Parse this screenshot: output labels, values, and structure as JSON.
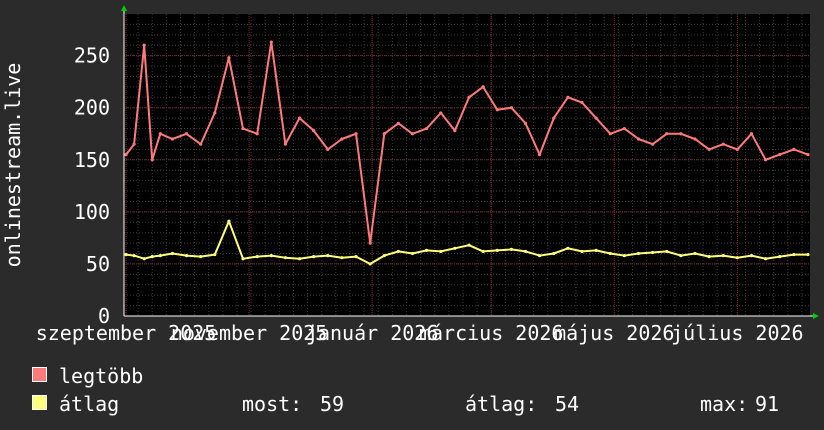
{
  "chart_data": {
    "type": "line",
    "ylabel": "onlinestream.live",
    "ylim": [
      0,
      290
    ],
    "yticks": [
      0,
      50,
      100,
      150,
      200,
      250
    ],
    "x_tick_labels": [
      "szeptember 2025",
      "november 2025",
      "január 2026",
      "március 2026",
      "május 2026",
      "július 2026"
    ],
    "x_range": [
      "2025-08-31",
      "2026-08-06"
    ],
    "x_tick_dates": [
      "2025-09-01",
      "2025-11-01",
      "2026-01-01",
      "2026-03-01",
      "2026-05-01",
      "2026-07-01"
    ],
    "grid": true,
    "colors": {
      "max": "#ff7b7b",
      "avg": "#ffff7b",
      "background": "#000000",
      "grid_minor": "#3a3a3a",
      "grid_major": "#7a2a2a",
      "axis_arrow": "#00cc00"
    },
    "series": [
      {
        "name": "legtöbb",
        "color": "#ff7b7b",
        "x": [
          "2025-09-01",
          "2025-09-05",
          "2025-09-10",
          "2025-09-14",
          "2025-09-18",
          "2025-09-24",
          "2025-10-01",
          "2025-10-08",
          "2025-10-15",
          "2025-10-22",
          "2025-10-29",
          "2025-11-05",
          "2025-11-12",
          "2025-11-19",
          "2025-11-26",
          "2025-12-03",
          "2025-12-10",
          "2025-12-17",
          "2025-12-24",
          "2025-12-31",
          "2026-01-07",
          "2026-01-14",
          "2026-01-21",
          "2026-01-28",
          "2026-02-04",
          "2026-02-11",
          "2026-02-18",
          "2026-02-25",
          "2026-03-04",
          "2026-03-11",
          "2026-03-18",
          "2026-03-25",
          "2026-04-01",
          "2026-04-08",
          "2026-04-15",
          "2026-04-22",
          "2026-04-29",
          "2026-05-06",
          "2026-05-13",
          "2026-05-20",
          "2026-05-27",
          "2026-06-03",
          "2026-06-10",
          "2026-06-17",
          "2026-06-24",
          "2026-07-01",
          "2026-07-08",
          "2026-07-15",
          "2026-07-22",
          "2026-07-29",
          "2026-08-05"
        ],
        "values": [
          155,
          165,
          260,
          150,
          175,
          170,
          175,
          165,
          195,
          248,
          180,
          175,
          263,
          165,
          190,
          178,
          160,
          170,
          175,
          70,
          175,
          185,
          175,
          180,
          195,
          178,
          210,
          220,
          198,
          200,
          185,
          155,
          190,
          210,
          205,
          190,
          175,
          180,
          170,
          165,
          175,
          175,
          170,
          160,
          165,
          160,
          175,
          150,
          155,
          160,
          155
        ]
      },
      {
        "name": "átlag",
        "color": "#ffff7b",
        "x": [
          "2025-09-01",
          "2025-09-05",
          "2025-09-10",
          "2025-09-14",
          "2025-09-18",
          "2025-09-24",
          "2025-10-01",
          "2025-10-08",
          "2025-10-15",
          "2025-10-22",
          "2025-10-29",
          "2025-11-05",
          "2025-11-12",
          "2025-11-19",
          "2025-11-26",
          "2025-12-03",
          "2025-12-10",
          "2025-12-17",
          "2025-12-24",
          "2025-12-31",
          "2026-01-07",
          "2026-01-14",
          "2026-01-21",
          "2026-01-28",
          "2026-02-04",
          "2026-02-11",
          "2026-02-18",
          "2026-02-25",
          "2026-03-04",
          "2026-03-11",
          "2026-03-18",
          "2026-03-25",
          "2026-04-01",
          "2026-04-08",
          "2026-04-15",
          "2026-04-22",
          "2026-04-29",
          "2026-05-06",
          "2026-05-13",
          "2026-05-20",
          "2026-05-27",
          "2026-06-03",
          "2026-06-10",
          "2026-06-17",
          "2026-06-24",
          "2026-07-01",
          "2026-07-08",
          "2026-07-15",
          "2026-07-22",
          "2026-07-29",
          "2026-08-05"
        ],
        "values": [
          59,
          58,
          55,
          57,
          58,
          60,
          58,
          57,
          59,
          91,
          55,
          57,
          58,
          56,
          55,
          57,
          58,
          56,
          57,
          50,
          58,
          62,
          60,
          63,
          62,
          65,
          68,
          62,
          63,
          64,
          62,
          58,
          60,
          65,
          62,
          63,
          60,
          58,
          60,
          61,
          62,
          58,
          60,
          57,
          58,
          56,
          58,
          55,
          57,
          59,
          59
        ]
      }
    ],
    "legend": [
      {
        "key": "max",
        "label": "legtöbb",
        "color": "#ff7b7b"
      },
      {
        "key": "avg",
        "label": "átlag",
        "color": "#ffff7b"
      }
    ],
    "stats": {
      "now_label": "most:",
      "now": "59",
      "avg_label": "átlag:",
      "avg": "54",
      "max_label": "max:",
      "max": "91"
    }
  }
}
